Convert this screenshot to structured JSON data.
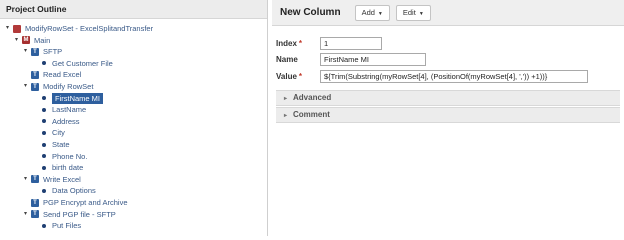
{
  "left": {
    "header": "Project Outline",
    "tree": [
      {
        "label": "ModifyRowSet - ExcelSplitandTransfer",
        "icon": "project",
        "depth": 0,
        "toggle": "▾"
      },
      {
        "label": "Main",
        "icon": "module",
        "depth": 1,
        "toggle": "▾"
      },
      {
        "label": "SFTP",
        "icon": "task",
        "depth": 2,
        "toggle": "▾"
      },
      {
        "label": "Get Customer File",
        "icon": "dot",
        "depth": 3,
        "toggle": ""
      },
      {
        "label": "Read Excel",
        "icon": "task",
        "depth": 2,
        "toggle": ""
      },
      {
        "label": "Modify RowSet",
        "icon": "task",
        "depth": 2,
        "toggle": "▾"
      },
      {
        "label": "FirstName MI",
        "icon": "dot",
        "depth": 3,
        "toggle": "",
        "selected": true
      },
      {
        "label": "LastName",
        "icon": "dot",
        "depth": 3,
        "toggle": ""
      },
      {
        "label": "Address",
        "icon": "dot",
        "depth": 3,
        "toggle": ""
      },
      {
        "label": "City",
        "icon": "dot",
        "depth": 3,
        "toggle": ""
      },
      {
        "label": "State",
        "icon": "dot",
        "depth": 3,
        "toggle": ""
      },
      {
        "label": "Phone No.",
        "icon": "dot",
        "depth": 3,
        "toggle": ""
      },
      {
        "label": "birth date",
        "icon": "dot",
        "depth": 3,
        "toggle": ""
      },
      {
        "label": "Write Excel",
        "icon": "task",
        "depth": 2,
        "toggle": "▾"
      },
      {
        "label": "Data Options",
        "icon": "dot",
        "depth": 3,
        "toggle": ""
      },
      {
        "label": "PGP Encrypt and Archive",
        "icon": "task",
        "depth": 2,
        "toggle": ""
      },
      {
        "label": "Send PGP file - SFTP",
        "icon": "task",
        "depth": 2,
        "toggle": "▾"
      },
      {
        "label": "Put Files",
        "icon": "dot",
        "depth": 3,
        "toggle": ""
      }
    ]
  },
  "right": {
    "title": "New Column",
    "add_label": "Add",
    "edit_label": "Edit",
    "index_label": "Index",
    "index_value": "1",
    "name_label": "Name",
    "name_value": "FirstName MI",
    "value_label": "Value",
    "value_value": "${Trim(Substring(myRowSet[4], (PositionOf(myRowSet[4], ',')) +1))}",
    "required_mark": "*",
    "advanced_label": "Advanced",
    "comment_label": "Comment"
  }
}
